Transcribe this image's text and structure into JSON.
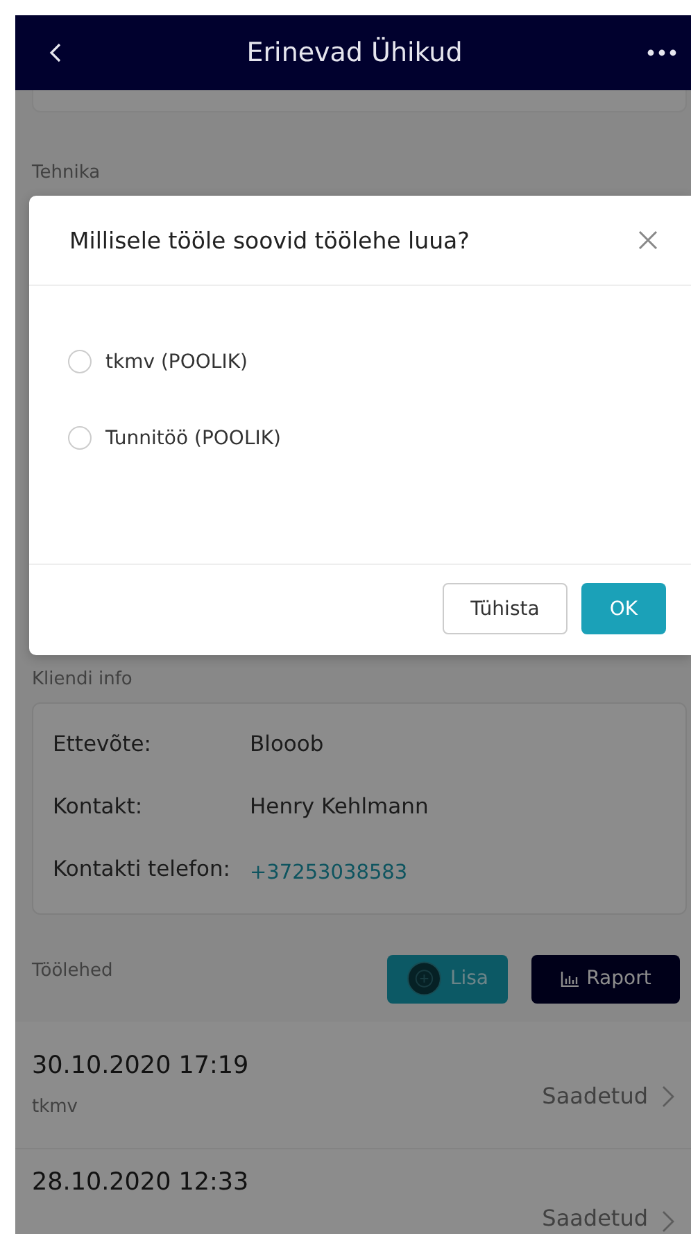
{
  "header": {
    "title": "Erinevad Ühikud"
  },
  "sections": {
    "equipment_label": "Tehnika",
    "client_label": "Kliendi info",
    "worksheets_label": "Töölehed"
  },
  "client_info": [
    {
      "label": "Ettevõte:",
      "value": "Blooob",
      "kind": "text"
    },
    {
      "label": "Kontakt:",
      "value": "Henry Kehlmann",
      "kind": "text"
    },
    {
      "label": "Kontakti telefon:",
      "value": "+37253038583",
      "kind": "link"
    }
  ],
  "worksheet_actions": [
    {
      "label": "Lisa",
      "kind": "add"
    },
    {
      "label": "Raport",
      "kind": "report"
    }
  ],
  "worksheets": [
    {
      "date": "30.10.2020 17:19",
      "name": "tkmv",
      "status": "Saadetud"
    },
    {
      "date": "28.10.2020 12:33",
      "status": "Saadetud"
    }
  ],
  "dialog": {
    "title": "Millisele tööle soovid töölehe luua?",
    "options": [
      {
        "label": "tkmv (POOLIK)",
        "selected": false
      },
      {
        "label": "Tunnitöö (POOLIK)",
        "selected": false
      }
    ],
    "buttons": [
      {
        "label": "Tühista",
        "kind": "default"
      },
      {
        "label": "OK",
        "kind": "primary"
      }
    ]
  }
}
